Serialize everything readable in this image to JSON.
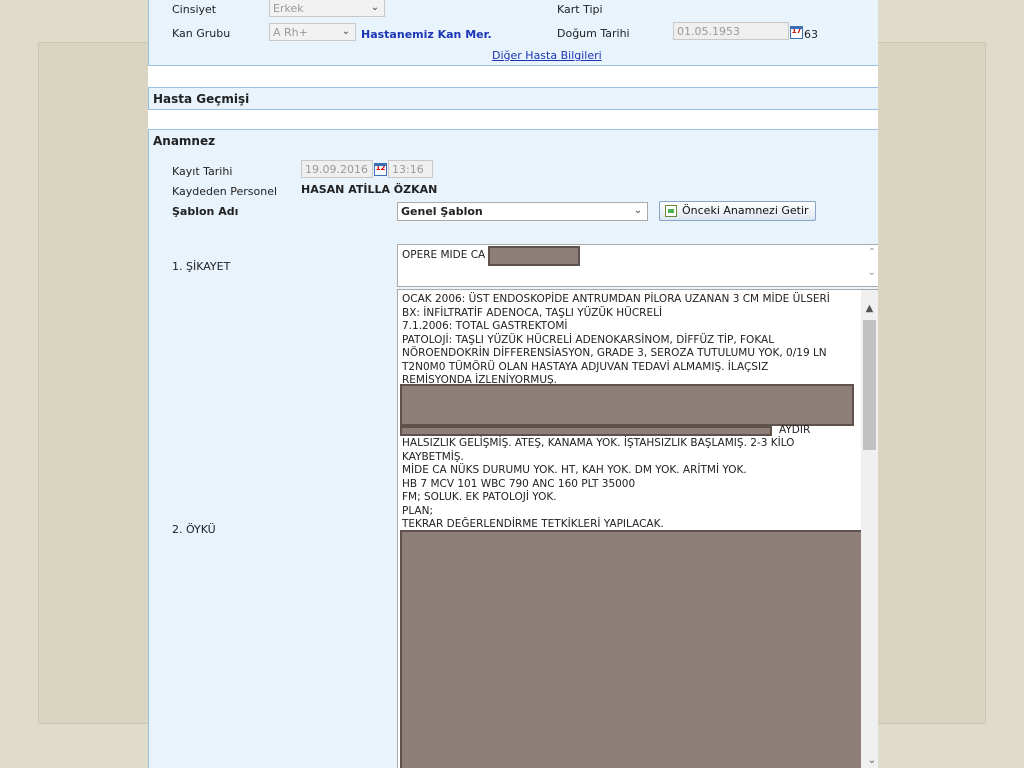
{
  "patient_info": {
    "gender_label": "Cinsiyet",
    "gender_value": "Erkek",
    "card_type_label": "Kart Tipi",
    "blood_group_label": "Kan Grubu",
    "blood_group_value": "A Rh+",
    "hospital_blood_link": "Hastanemiz Kan Mer.",
    "birth_date_label": "Doğum Tarihi",
    "birth_date_value": "01.05.1953",
    "age_value": "63",
    "other_info_link": "Diğer Hasta Bilgileri"
  },
  "history_section": {
    "title": "Hasta Geçmişi"
  },
  "anamnesis": {
    "title": "Anamnez",
    "record_date_label": "Kayıt Tarihi",
    "record_date_value": "19.09.2016",
    "record_time_value": "13:16",
    "recorded_by_label": "Kaydeden Personel",
    "recorded_by_value": "HASAN ATİLLA ÖZKAN",
    "template_label": "Şablon Adı",
    "template_value": "Genel Şablon",
    "previous_button": "Önceki Anamnezi Getir",
    "complaint_label": "1. ŞİKAYET",
    "complaint_text": "OPERE MIDE CA",
    "history_label": "2. ÖYKÜ",
    "history_lines": [
      "OCAK 2006: ÜST ENDOSKOPİDE ANTRUMDAN PİLORA UZANAN 3 CM MİDE ÜLSERİ",
      "BX: İNFİLTRATİF ADENOCA, TAŞLI YÜZÜK HÜCRELİ",
      "7.1.2006: TOTAL GASTREKTOMİ",
      "PATOLOJİ: TAŞLI YÜZÜK HÜCRELİ ADENOKARSİNOM, DİFFÜZ TİP, FOKAL",
      "NÖROENDOKRİN DİFFERENSİASYON, GRADE 3, SEROZA TUTULUMU YOK, 0/19 LN",
      "T2N0M0 TÜMÖRÜ OLAN HASTAYA ADJUVAN TEDAVİ ALMAMIŞ.  İLAÇSIZ",
      "REMİSYONDA İZLENİYORMUŞ."
    ],
    "history_fragment": "AYDIR",
    "history_lines_2": [
      "HALSIZLIK GELİŞMİŞ. ATEŞ, KANAMA YOK. İŞTAHSIZLIK BAŞLAMIŞ. 2-3 KİLO",
      "KAYBETMİŞ.",
      "MİDE CA NÜKS DURUMU YOK. HT, KAH YOK. DM YOK. ARİTMİ YOK.",
      "HB 7 MCV 101 WBC 790 ANC 160 PLT 35000",
      "FM; SOLUK. EK PATOLOJİ YOK.",
      "PLAN;",
      "TEKRAR DEĞERLENDİRME TETKİKLERİ YAPILACAK."
    ]
  },
  "icons": {
    "calendar": "calendar-icon",
    "dropdown": "chevron-down-icon",
    "fetch": "fetch-previous-icon"
  }
}
